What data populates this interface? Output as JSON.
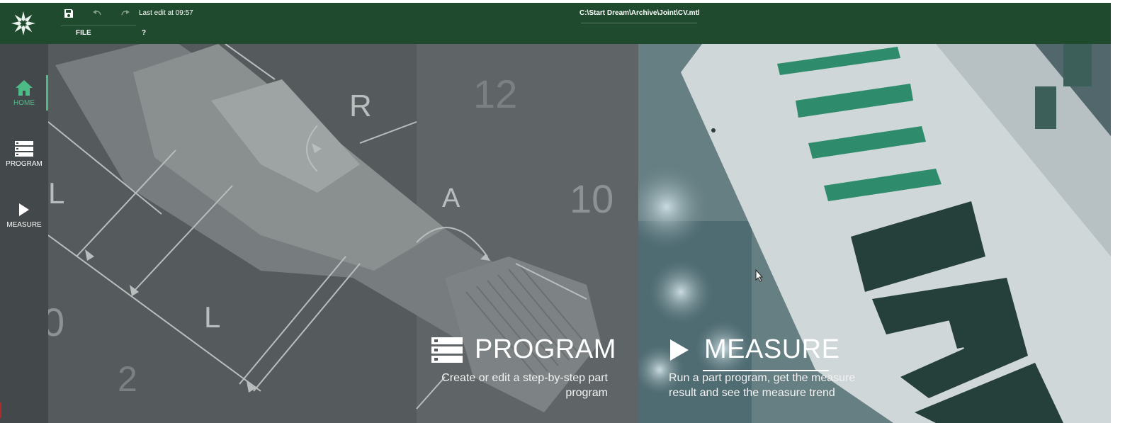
{
  "topbar": {
    "last_edit": "Last edit at 09:57",
    "menu": {
      "file": "FILE",
      "help": "?"
    },
    "file_path": "C:\\Start Dream\\Archive\\Joint\\CV.mtl",
    "icons": {
      "save": "save-icon",
      "undo": "undo-icon",
      "redo": "redo-icon",
      "logo": "logo-star-icon"
    }
  },
  "sidebar": {
    "items": [
      {
        "label": "HOME",
        "icon": "home-icon",
        "active": true
      },
      {
        "label": "PROGRAM",
        "icon": "list-icon",
        "active": false
      },
      {
        "label": "MEASURE",
        "icon": "play-icon",
        "active": false
      }
    ]
  },
  "program_card": {
    "title": "PROGRAM",
    "description_line1": "Create or edit a step-by-step part",
    "description_line2": "program",
    "drawing_labels": {
      "r": "R",
      "a": "A",
      "l1": "L",
      "l2": "L",
      "n12": "12",
      "n10": "10",
      "n0": "0",
      "n2": "2"
    }
  },
  "measure_card": {
    "title": "MEASURE",
    "description_line1": "Run a part program, get the measure",
    "description_line2": "result and see the measure trend"
  },
  "colors": {
    "header": "#1f4a2d",
    "sidebar": "#43484b",
    "accent": "#4dbb85",
    "program_bg": "#555b5d",
    "measure_bg": "#6c8487"
  }
}
